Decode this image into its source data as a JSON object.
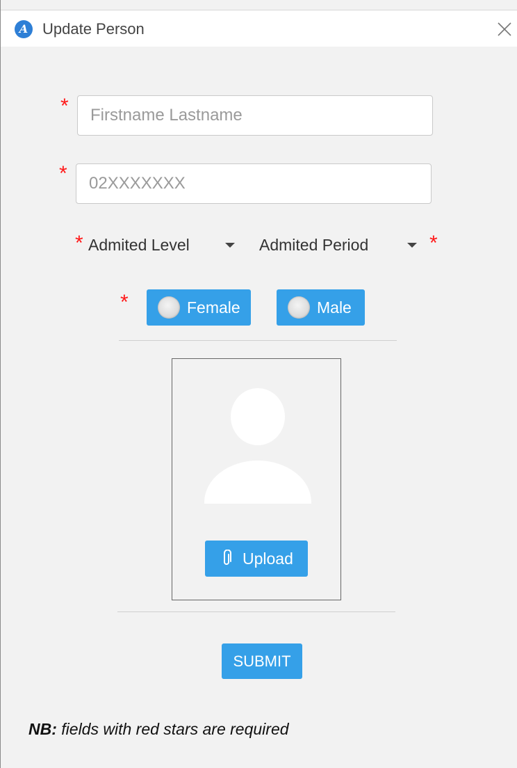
{
  "window": {
    "title": "Update Person",
    "app_icon_glyph": "A"
  },
  "form": {
    "required_marker": "*",
    "name_field": {
      "placeholder": "Firstname Lastname",
      "value": ""
    },
    "phone_field": {
      "placeholder": "02XXXXXXX",
      "value": ""
    },
    "admitted_level": {
      "label": "Admited Level"
    },
    "admitted_period": {
      "label": "Admited Period"
    },
    "gender": {
      "female_label": "Female",
      "male_label": "Male"
    },
    "upload_label": "Upload",
    "submit_label": "SUBMIT"
  },
  "note": {
    "prefix": "NB:",
    "text": " fields with red stars are required"
  },
  "colors": {
    "accent": "#35a0e8",
    "required_star": "#ff1a1a",
    "background": "#f2f2f2"
  },
  "icons": [
    "app-logo-icon",
    "close-icon",
    "caret-down-icon",
    "radio-icon",
    "avatar-placeholder-icon",
    "paperclip-icon"
  ]
}
